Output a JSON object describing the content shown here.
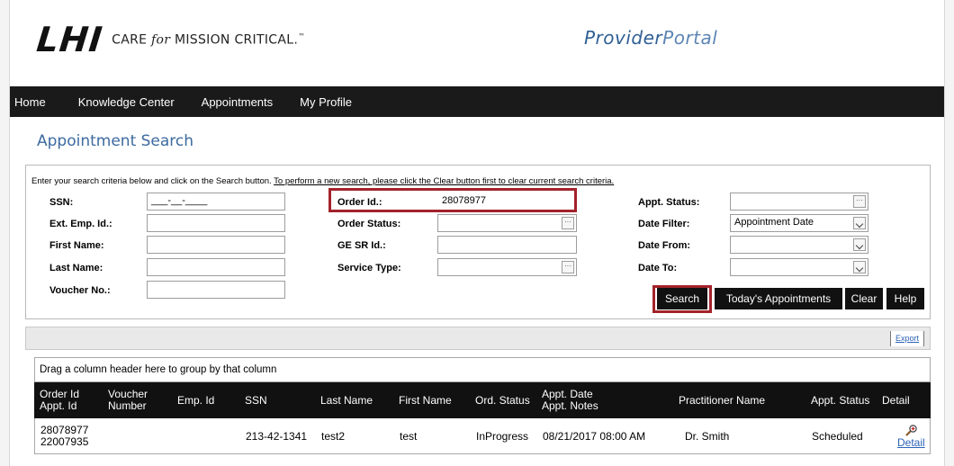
{
  "header": {
    "logo_text": "LHI",
    "tagline_prefix": "CARE ",
    "tagline_italic": "for",
    "tagline_suffix": " MISSION CRITICAL.",
    "tagline_tm": "™",
    "portal_strong": "Provider",
    "portal_light": "Portal"
  },
  "nav": {
    "items": [
      "Home",
      "Knowledge Center",
      "Appointments",
      "My Profile"
    ]
  },
  "page": {
    "title": "Appointment Search"
  },
  "search": {
    "instructions_pre": "Enter your search criteria below and click on the Search button. ",
    "instructions_link": "To perform a new search, please click the Clear button first to clear current search criteria.",
    "fields": {
      "ssn": {
        "label": "SSN:",
        "value": "___-__-____"
      },
      "ext_emp_id": {
        "label": "Ext. Emp. Id.:",
        "value": ""
      },
      "first_name": {
        "label": "First Name:",
        "value": ""
      },
      "last_name": {
        "label": "Last Name:",
        "value": ""
      },
      "voucher_no": {
        "label": "Voucher No.:",
        "value": ""
      },
      "order_id": {
        "label": "Order Id.:",
        "value": "28078977"
      },
      "order_status": {
        "label": "Order Status:",
        "value": ""
      },
      "ge_sr_id": {
        "label": "GE SR Id.:",
        "value": ""
      },
      "service_type": {
        "label": "Service Type:",
        "value": ""
      },
      "appt_status": {
        "label": "Appt. Status:",
        "value": ""
      },
      "date_filter": {
        "label": "Date Filter:",
        "value": "Appointment Date"
      },
      "date_from": {
        "label": "Date From:",
        "value": ""
      },
      "date_to": {
        "label": "Date To:",
        "value": ""
      }
    },
    "buttons": {
      "search": "Search",
      "today": "Today's Appointments",
      "clear": "Clear",
      "help": "Help"
    },
    "highlight_color": "#a3232a"
  },
  "grid": {
    "export_label": "Export",
    "group_hint": "Drag a column header here to group by that column",
    "headers": {
      "order_id": [
        "Order Id",
        "Appt. Id"
      ],
      "voucher": [
        "Voucher",
        "Number"
      ],
      "emp_id": "Emp. Id",
      "ssn": "SSN",
      "last_name": "Last Name",
      "first_name": "First Name",
      "ord_status": "Ord. Status",
      "appt_date": [
        "Appt. Date",
        "Appt. Notes"
      ],
      "practitioner": "Practitioner Name",
      "appt_status": "Appt. Status",
      "detail": "Detail"
    },
    "rows": [
      {
        "order_id": "28078977",
        "appt_id": "22007935",
        "voucher": "",
        "emp_id": "",
        "ssn": "213-42-1341",
        "last_name": "test2",
        "first_name": "test",
        "ord_status": "InProgress",
        "appt_date": "08/21/2017 08:00 AM",
        "practitioner": "Dr. Smith",
        "appt_status": "Scheduled",
        "detail_label": "Detail"
      }
    ]
  }
}
